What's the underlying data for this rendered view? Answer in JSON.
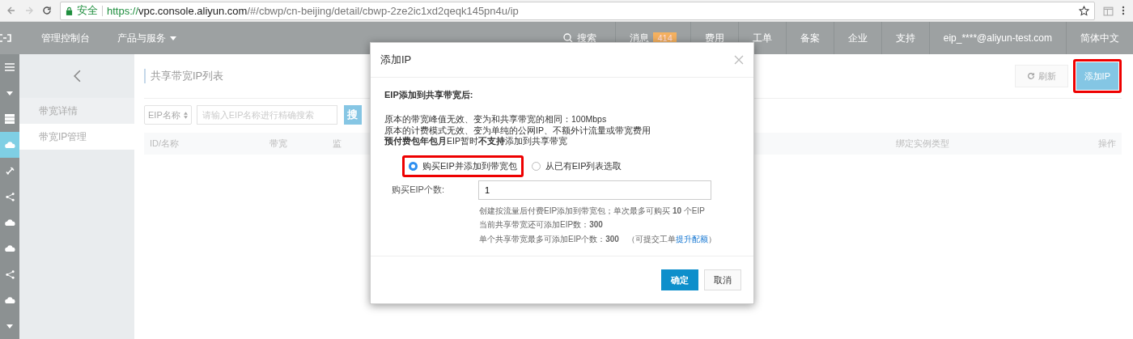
{
  "browser": {
    "secure_label": "安全",
    "url_scheme": "https://",
    "url_host": "vpc.console.aliyun.com",
    "url_path": "/#/cbwp/cn-beijing/detail/cbwp-2ze2ic1xd2qeqk145pn4u/ip"
  },
  "topnav": {
    "left": [
      {
        "label": "管理控制台",
        "dropdown": false
      },
      {
        "label": "产品与服务",
        "dropdown": true
      }
    ],
    "search": "搜索",
    "right": [
      {
        "label": "消息",
        "badge": "414"
      },
      {
        "label": "费用"
      },
      {
        "label": "工单"
      },
      {
        "label": "备案"
      },
      {
        "label": "企业"
      },
      {
        "label": "支持"
      },
      {
        "label": "eip_****@aliyun-test.com"
      },
      {
        "label": "简体中文"
      }
    ]
  },
  "rail": [
    {
      "kind": "menu",
      "selected": false
    },
    {
      "kind": "caret",
      "selected": false
    },
    {
      "kind": "server",
      "selected": false
    },
    {
      "kind": "cloud",
      "selected": true
    },
    {
      "kind": "link",
      "selected": false
    },
    {
      "kind": "nodes",
      "selected": false
    },
    {
      "kind": "cloud",
      "selected": false
    },
    {
      "kind": "cloud",
      "selected": false
    },
    {
      "kind": "nodes",
      "selected": false
    },
    {
      "kind": "cloud",
      "selected": false
    },
    {
      "kind": "caret",
      "selected": false
    }
  ],
  "sidebar": {
    "items": [
      {
        "label": "带宽详情",
        "selected": false
      },
      {
        "label": "带宽IP管理",
        "selected": true
      }
    ]
  },
  "page": {
    "title": "共享带宽IP列表",
    "refresh": "刷新",
    "add": "添加IP",
    "filter_select": "EIP名称",
    "search_placeholder": "请输入EIP名称进行精确搜索",
    "search_button": "搜",
    "columns": [
      "ID/名称",
      "带宽",
      "监",
      "绑定实例类型",
      "操作"
    ]
  },
  "dialog": {
    "title": "添加IP",
    "heading": "EIP添加到共享带宽后:",
    "notes": [
      "原本的带宽峰值无效、变为和共享带宽的相同：100Mbps",
      "原本的计费模式无效、变为单纯的公网IP、不额外计流量或带宽费用",
      "**预付费包年包月**EIP暂时**不支持**添加到共享带宽"
    ],
    "options": [
      {
        "label": "购买EIP并添加到带宽包",
        "selected": true
      },
      {
        "label": "从已有EIP列表选取",
        "selected": false
      }
    ],
    "count_label": "购买EIP个数:",
    "count_value": "1",
    "hints": [
      "创建按流量后付费EIP添加到带宽包；单次最多可购买 **10** 个EIP",
      "当前共享带宽还可添加EIP数：**300**"
    ],
    "quota_text": "单个共享带宽最多可添加EIP个数：**300**　（可提交工单",
    "quota_link": "提升配额",
    "quota_close": "）",
    "ok": "确定",
    "cancel": "取消"
  }
}
